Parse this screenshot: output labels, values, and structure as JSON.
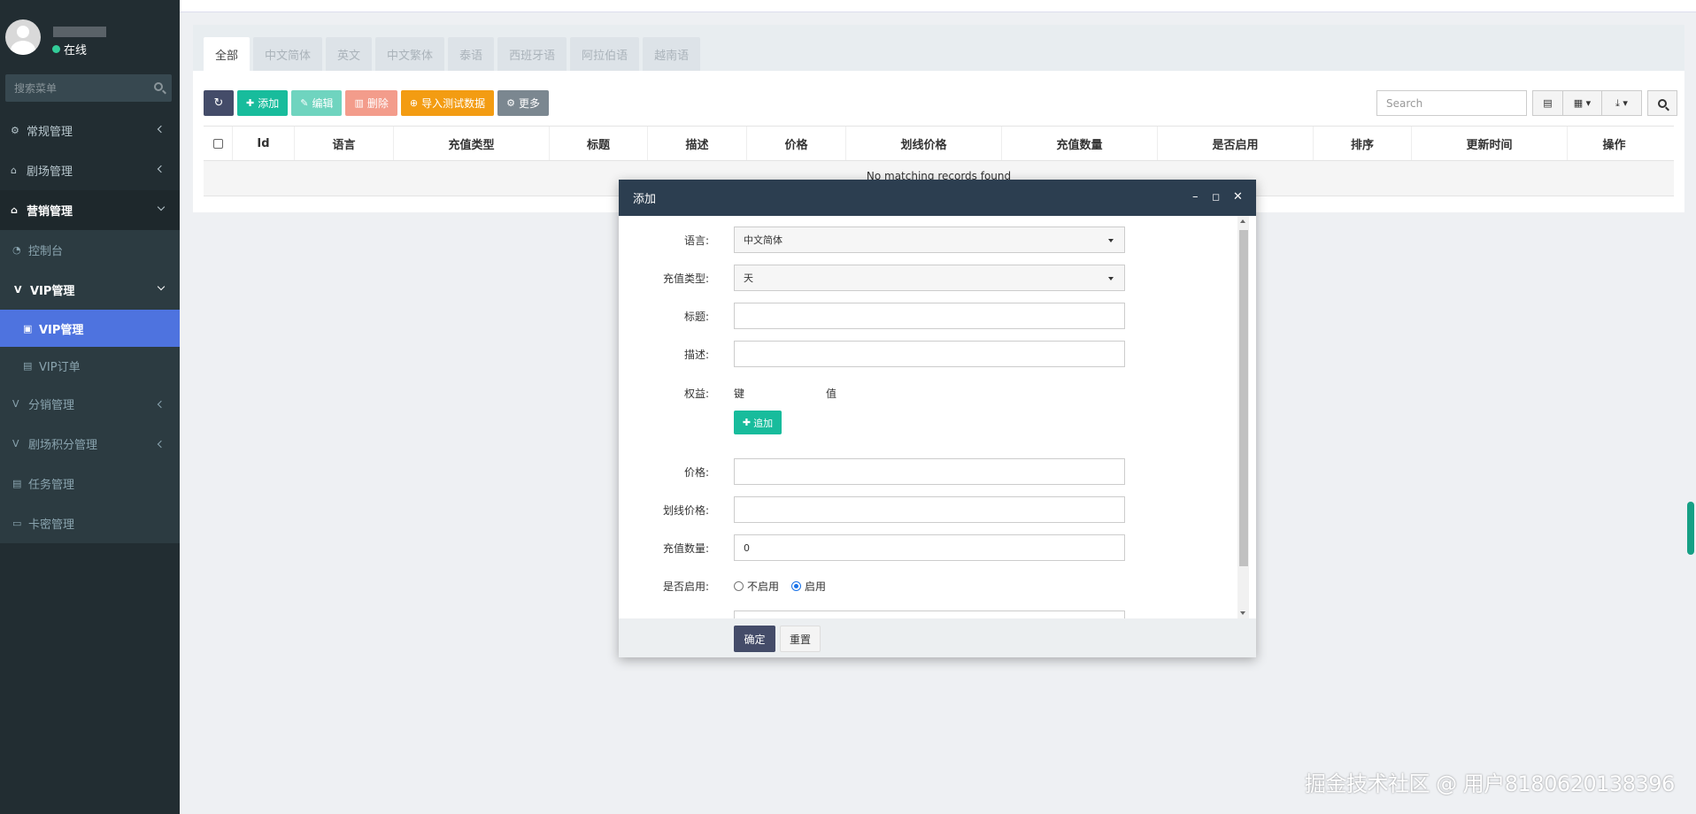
{
  "colors": {
    "sidebar_bg": "#222d32",
    "active_blue": "#4e73df",
    "green": "#18bc9c",
    "modal_head": "#2c3e50"
  },
  "user": {
    "status": "在线"
  },
  "sidebar": {
    "search_placeholder": "搜索菜单",
    "items": [
      {
        "label": "常规管理",
        "icon": "cogs-icon"
      },
      {
        "label": "剧场管理",
        "icon": "home-icon"
      },
      {
        "label": "营销管理",
        "icon": "home-icon"
      }
    ],
    "marketing": {
      "dashboard": "控制台",
      "vip_group": "VIP管理",
      "vip_manage": "VIP管理",
      "vip_orders": "VIP订单",
      "distribution": "分销管理",
      "points": "剧场积分管理",
      "tasks": "任务管理",
      "cards": "卡密管理"
    }
  },
  "tabs": [
    "全部",
    "中文简体",
    "英文",
    "中文繁体",
    "泰语",
    "西班牙语",
    "阿拉伯语",
    "越南语"
  ],
  "toolbar": {
    "add": "添加",
    "edit": "编辑",
    "delete": "删除",
    "import": "导入测试数据",
    "more": "更多",
    "search_placeholder": "Search"
  },
  "table": {
    "columns": [
      "Id",
      "语言",
      "充值类型",
      "标题",
      "描述",
      "价格",
      "划线价格",
      "充值数量",
      "是否启用",
      "排序",
      "更新时间",
      "操作"
    ],
    "empty": "No matching records found"
  },
  "modal": {
    "title": "添加",
    "fields": {
      "language_label": "语言:",
      "language_value": "中文简体",
      "type_label": "充值类型:",
      "type_value": "天",
      "title_label": "标题:",
      "desc_label": "描述:",
      "rights_label": "权益:",
      "key_label": "键",
      "value_label": "值",
      "add_label": "追加",
      "price_label": "价格:",
      "strike_label": "划线价格:",
      "qty_label": "充值数量:",
      "qty_value": "0",
      "enabled_label": "是否启用:",
      "disable_opt": "不启用",
      "enable_opt": "启用"
    },
    "ok": "确定",
    "reset": "重置"
  },
  "watermark": "掘金技术社区 @ 用户8180620138396"
}
